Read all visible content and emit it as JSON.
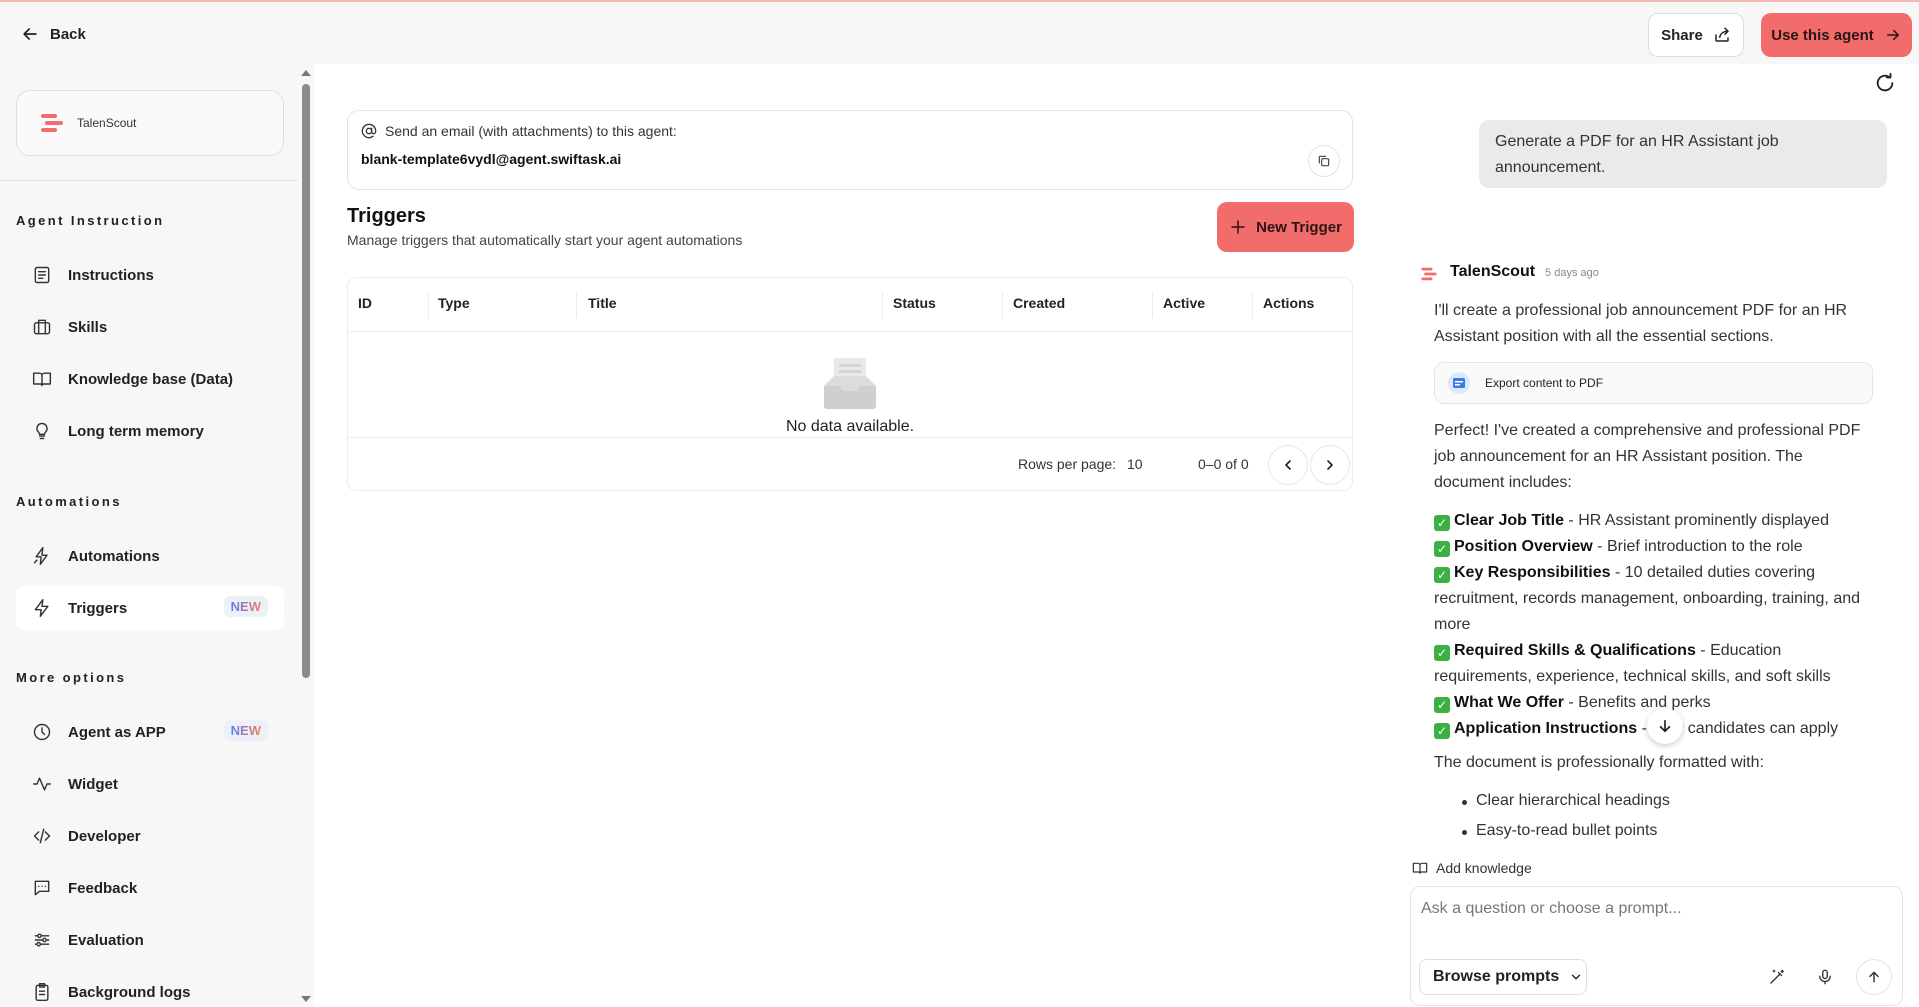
{
  "topbar": {
    "back_label": "Back",
    "share_label": "Share",
    "use_agent_label": "Use this agent"
  },
  "sidebar": {
    "agent_name": "TalenScout",
    "sections": {
      "agent_instruction": "Agent Instruction",
      "automations": "Automations",
      "more_options": "More options"
    },
    "items": [
      {
        "label": "Instructions",
        "icon": "instructions-icon"
      },
      {
        "label": "Skills",
        "icon": "skills-icon"
      },
      {
        "label": "Knowledge base (Data)",
        "icon": "book-icon"
      },
      {
        "label": "Long term memory",
        "icon": "bulb-icon"
      },
      {
        "label": "Automations",
        "icon": "automations-icon"
      },
      {
        "label": "Triggers",
        "icon": "lightning-icon",
        "badge": "NEW",
        "active": true
      },
      {
        "label": "Agent as APP",
        "icon": "app-icon",
        "badge": "NEW"
      },
      {
        "label": "Widget",
        "icon": "widget-icon"
      },
      {
        "label": "Developer",
        "icon": "code-icon"
      },
      {
        "label": "Feedback",
        "icon": "feedback-icon"
      },
      {
        "label": "Evaluation",
        "icon": "sliders-icon"
      },
      {
        "label": "Background logs",
        "icon": "clipboard-icon"
      }
    ]
  },
  "main": {
    "email_label": "Send an email (with attachments) to this agent:",
    "email_address": "blank-template6vydl@agent.swiftask.ai",
    "triggers_title": "Triggers",
    "triggers_subtitle": "Manage triggers that automatically start your agent automations",
    "new_trigger_label": "New Trigger",
    "table": {
      "columns": [
        "ID",
        "Type",
        "Title",
        "Status",
        "Created",
        "Active",
        "Actions"
      ],
      "empty_text": "No data available.",
      "rows_per_page_label": "Rows per page:",
      "rows_per_page_value": "10",
      "range_text": "0–0 of 0"
    }
  },
  "chat": {
    "user_message": "Generate a PDF for an HR Assistant job announcement.",
    "bot_name": "TalenScout",
    "bot_time": "5 days ago",
    "intro": "I'll create a professional job announcement PDF for an HR Assistant position with all the essential sections.",
    "tool_chip": "Export content to PDF",
    "summary": "Perfect! I've created a comprehensive and professional PDF job announcement for an HR Assistant position. The document includes:",
    "checklist": [
      {
        "title": "Clear Job Title",
        "text": " - HR Assistant prominently displayed"
      },
      {
        "title": "Position Overview",
        "text": " - Brief introduction to the role"
      },
      {
        "title": "Key Responsibilities",
        "text": " - 10 detailed duties covering recruitment, records management, onboarding, training, and more"
      },
      {
        "title": "Required Skills & Qualifications",
        "text": " - Education requirements, experience, technical skills, and soft skills"
      },
      {
        "title": "What We Offer",
        "text": " - Benefits and perks"
      },
      {
        "title": "Application Instructions",
        "text": " - How candidates can apply"
      }
    ],
    "formatted_intro": "The document is professionally formatted with:",
    "bullets": [
      "Clear hierarchical headings",
      "Easy-to-read bullet points"
    ],
    "add_knowledge_label": "Add knowledge",
    "input_placeholder": "Ask a question or choose a prompt...",
    "browse_prompts_label": "Browse prompts"
  },
  "colors": {
    "accent": "#f26c6c",
    "check": "#3cb043"
  }
}
